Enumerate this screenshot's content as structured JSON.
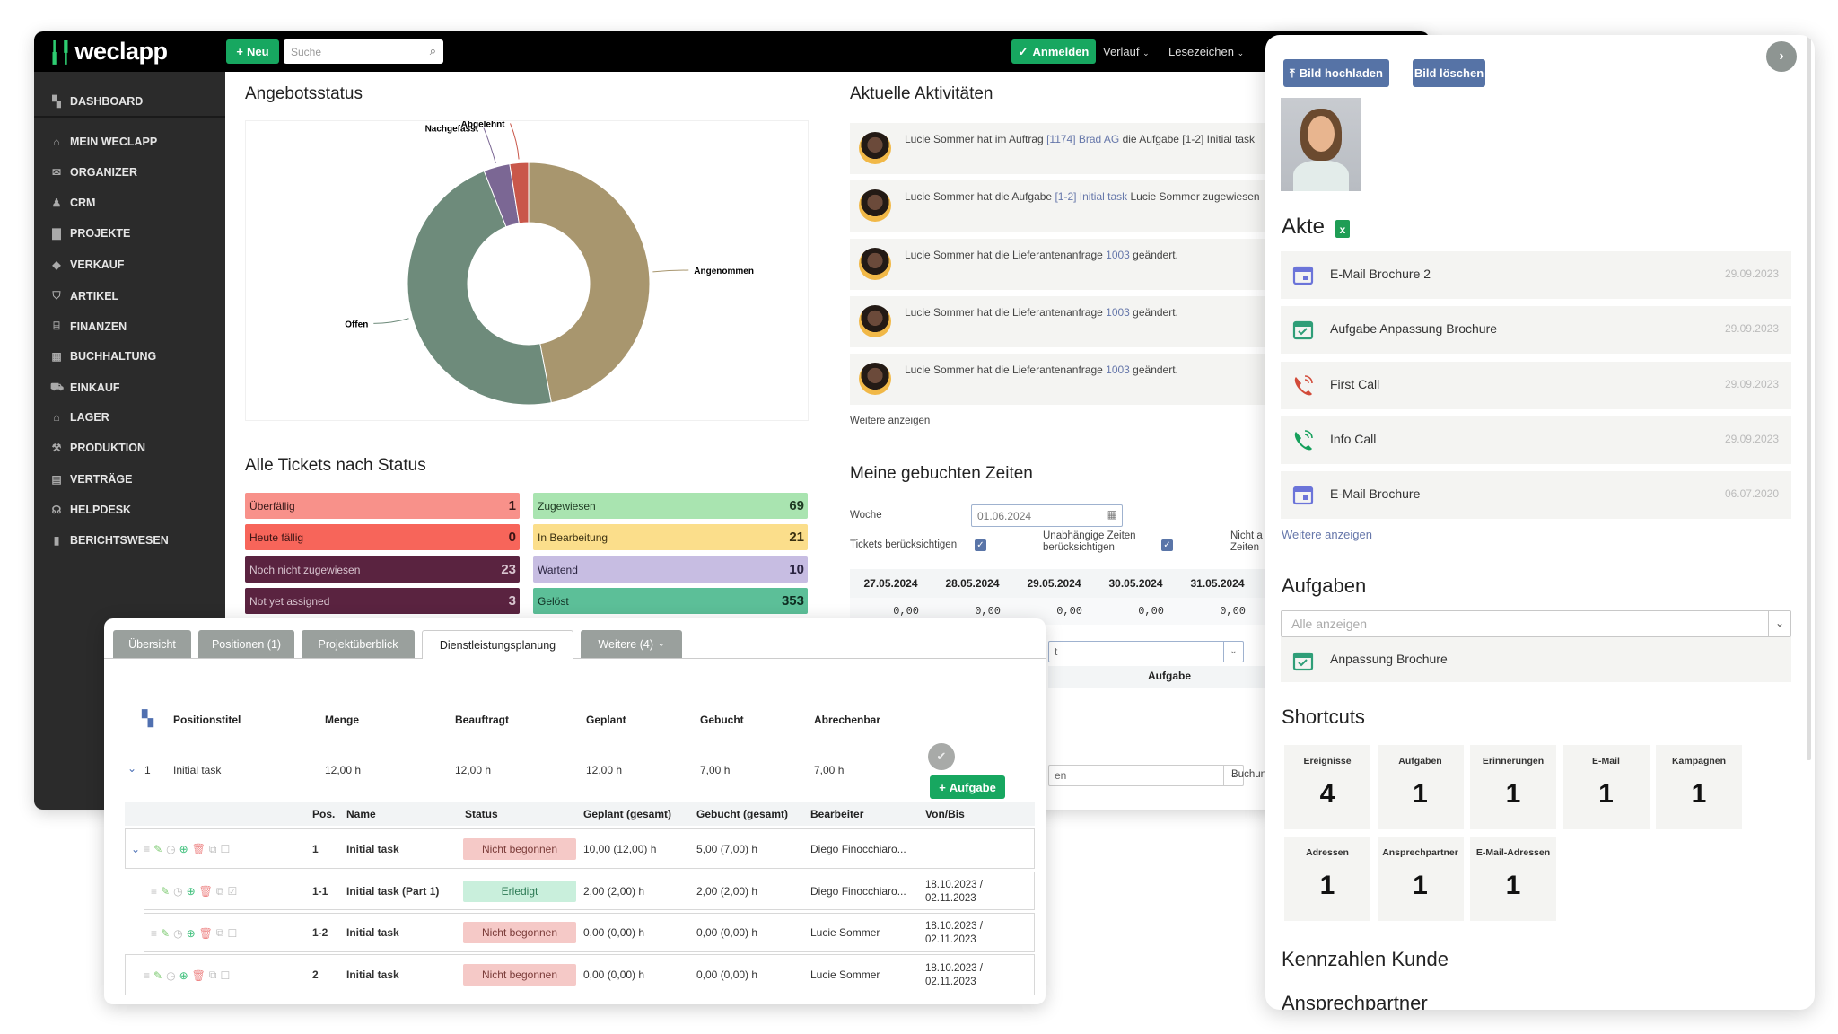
{
  "topbar": {
    "logo": "weclapp",
    "new_label": "Neu",
    "search_placeholder": "Suche",
    "login_label": "Anmelden",
    "history_label": "Verlauf",
    "bookmarks_label": "Lesezeichen"
  },
  "sidebar": {
    "items": [
      {
        "label": "DASHBOARD",
        "icon": "dashboard-icon"
      },
      {
        "label": "MEIN WECLAPP",
        "icon": "home-icon"
      },
      {
        "label": "ORGANIZER",
        "icon": "mail-icon"
      },
      {
        "label": "CRM",
        "icon": "crm-icon"
      },
      {
        "label": "PROJEKTE",
        "icon": "briefcase-icon"
      },
      {
        "label": "VERKAUF",
        "icon": "tag-icon"
      },
      {
        "label": "ARTIKEL",
        "icon": "article-icon"
      },
      {
        "label": "FINANZEN",
        "icon": "bank-icon"
      },
      {
        "label": "BUCHHALTUNG",
        "icon": "calculator-icon"
      },
      {
        "label": "EINKAUF",
        "icon": "cart-icon"
      },
      {
        "label": "LAGER",
        "icon": "warehouse-icon"
      },
      {
        "label": "PRODUKTION",
        "icon": "wrench-icon"
      },
      {
        "label": "VERTRÄGE",
        "icon": "contract-icon"
      },
      {
        "label": "HELPDESK",
        "icon": "headset-icon"
      },
      {
        "label": "BERICHTSWESEN",
        "icon": "bar-chart-icon"
      }
    ]
  },
  "offers": {
    "title": "Angebotsstatus"
  },
  "chart_data": {
    "type": "pie",
    "variant": "donut",
    "categories": [
      "Angenommen",
      "Offen",
      "Nachgefasst",
      "Abgelehnt"
    ],
    "values": [
      47,
      47,
      3.5,
      2.5
    ],
    "colors": [
      "#a8966e",
      "#6e8b7b",
      "#7b6794",
      "#c9574a"
    ]
  },
  "activities": {
    "title": "Aktuelle Aktivitäten",
    "items": [
      {
        "pre": "Lucie Sommer hat im Auftrag ",
        "link": "[1174] Brad AG",
        "post": " die Aufgabe [1-2] Initial task"
      },
      {
        "pre": "Lucie Sommer hat die Aufgabe ",
        "link": "[1-2] Initial task",
        "post": " Lucie Sommer zugewiesen"
      },
      {
        "pre": "Lucie Sommer hat die Lieferantenanfrage ",
        "link": "1003",
        "post": " geändert."
      },
      {
        "pre": "Lucie Sommer hat die Lieferantenanfrage ",
        "link": "1003",
        "post": " geändert."
      },
      {
        "pre": "Lucie Sommer hat die Lieferantenanfrage ",
        "link": "1003",
        "post": " geändert."
      }
    ],
    "more": "Weitere anzeigen"
  },
  "tickets": {
    "title": "Alle Tickets nach Status",
    "items": [
      {
        "label": "Überfällig",
        "count": "1",
        "color": "#f8918a",
        "text": "#3a1a1a"
      },
      {
        "label": "Zugewiesen",
        "count": "69",
        "color": "#a9e4b0",
        "text": "#1e3a22"
      },
      {
        "label": "Heute fällig",
        "count": "0",
        "color": "#f7655a",
        "text": "#3a1414"
      },
      {
        "label": "In Bearbeitung",
        "count": "21",
        "color": "#fbde8b",
        "text": "#3a3010"
      },
      {
        "label": "Noch nicht zugewiesen",
        "count": "23",
        "color": "#5a2340",
        "text": "#d8c4cf"
      },
      {
        "label": "Wartend",
        "count": "10",
        "color": "#c7bde2",
        "text": "#2a2440"
      },
      {
        "label": "Not yet assigned",
        "count": "3",
        "color": "#5a2340",
        "text": "#d8c4cf"
      },
      {
        "label": "Gelöst",
        "count": "353",
        "color": "#5cbf98",
        "text": "#0f2e22"
      }
    ]
  },
  "times": {
    "title": "Meine gebuchten Zeiten",
    "week_label": "Woche",
    "week_value": "01.06.2024",
    "tickets_label": "Tickets berücksichtigen",
    "independent_label_1": "Unabhängige Zeiten",
    "independent_label_2": "berücksichtigen",
    "other_label_1": "Nicht a",
    "other_label_2": "Zeiten",
    "dates": [
      "27.05.2024",
      "28.05.2024",
      "29.05.2024",
      "30.05.2024",
      "31.05.2024"
    ],
    "values": [
      "0,00",
      "0,00",
      "0,00",
      "0,00",
      "0,00"
    ],
    "select1_value": "t",
    "task_header": "Aufgabe",
    "select2_value": "en",
    "booking_link": "Buchun"
  },
  "project": {
    "tabs": [
      {
        "label": "Übersicht"
      },
      {
        "label": "Positionen (1)"
      },
      {
        "label": "Projektüberblick"
      },
      {
        "label": "Dienstleistungsplanung",
        "active": true
      },
      {
        "label": "Weitere (4)"
      }
    ],
    "position_headers": [
      "Positionstitel",
      "Menge",
      "Beauftragt",
      "Geplant",
      "Gebucht",
      "Abrechenbar"
    ],
    "position": {
      "nr": "1",
      "title": "Initial task",
      "values": [
        "12,00 h",
        "12,00 h",
        "12,00 h",
        "7,00 h",
        "7,00 h"
      ]
    },
    "add_task_label": "Aufgabe",
    "task_headers": [
      "Pos.",
      "Name",
      "Status",
      "Geplant (gesamt)",
      "Gebucht (gesamt)",
      "Bearbeiter",
      "Von/Bis"
    ],
    "tasks": [
      {
        "pos": "1",
        "name": "Initial task",
        "status": "Nicht begonnen",
        "planned": "10,00 (12,00) h",
        "booked": "5,00 (7,00) h",
        "assignee": "Diego Finocchiaro...",
        "from": "",
        "to": ""
      },
      {
        "pos": "1-1",
        "name": "Initial task (Part 1)",
        "status": "Erledigt",
        "planned": "2,00 (2,00) h",
        "booked": "2,00 (2,00) h",
        "assignee": "Diego Finocchiaro...",
        "from": "18.10.2023 /",
        "to": "02.11.2023"
      },
      {
        "pos": "1-2",
        "name": "Initial task",
        "status": "Nicht begonnen",
        "planned": "0,00 (0,00) h",
        "booked": "0,00 (0,00) h",
        "assignee": "Lucie Sommer",
        "from": "18.10.2023 /",
        "to": "02.11.2023"
      },
      {
        "pos": "2",
        "name": "Initial task",
        "status": "Nicht begonnen",
        "planned": "0,00 (0,00) h",
        "booked": "0,00 (0,00) h",
        "assignee": "Lucie Sommer",
        "from": "18.10.2023 /",
        "to": "02.11.2023"
      }
    ]
  },
  "contact": {
    "upload_label": "Bild hochladen",
    "delete_label": "Bild löschen",
    "file_title": "Akte",
    "file_items": [
      {
        "label": "E-Mail Brochure 2",
        "date": "29.09.2023",
        "icon": "calendar-icon",
        "color": "#6b74d9"
      },
      {
        "label": "Aufgabe Anpassung Brochure",
        "date": "29.09.2023",
        "icon": "task-calendar-icon",
        "color": "#2f9e78"
      },
      {
        "label": "First Call",
        "date": "29.09.2023",
        "icon": "phone-outgoing-icon",
        "color": "#d24b3a"
      },
      {
        "label": "Info Call",
        "date": "29.09.2023",
        "icon": "phone-incoming-icon",
        "color": "#16a05c"
      },
      {
        "label": "E-Mail Brochure",
        "date": "06.07.2020",
        "icon": "calendar-icon",
        "color": "#6b74d9"
      }
    ],
    "file_more": "Weitere anzeigen",
    "tasks_title": "Aufgaben",
    "tasks_filter_placeholder": "Alle anzeigen",
    "tasks_item": "Anpassung Brochure",
    "shortcuts_title": "Shortcuts",
    "shortcuts": [
      {
        "label": "Ereignisse",
        "value": "4"
      },
      {
        "label": "Aufgaben",
        "value": "1"
      },
      {
        "label": "Erinnerungen",
        "value": "1"
      },
      {
        "label": "E-Mail",
        "value": "1"
      },
      {
        "label": "Kampagnen",
        "value": "1"
      },
      {
        "label": "Adressen",
        "value": "1"
      },
      {
        "label": "Ansprechpartner",
        "value": "1"
      },
      {
        "label": "E-Mail-Adressen",
        "value": "1"
      }
    ],
    "kpi_title": "Kennzahlen Kunde",
    "contacts_title": "Ansprechpartner"
  }
}
